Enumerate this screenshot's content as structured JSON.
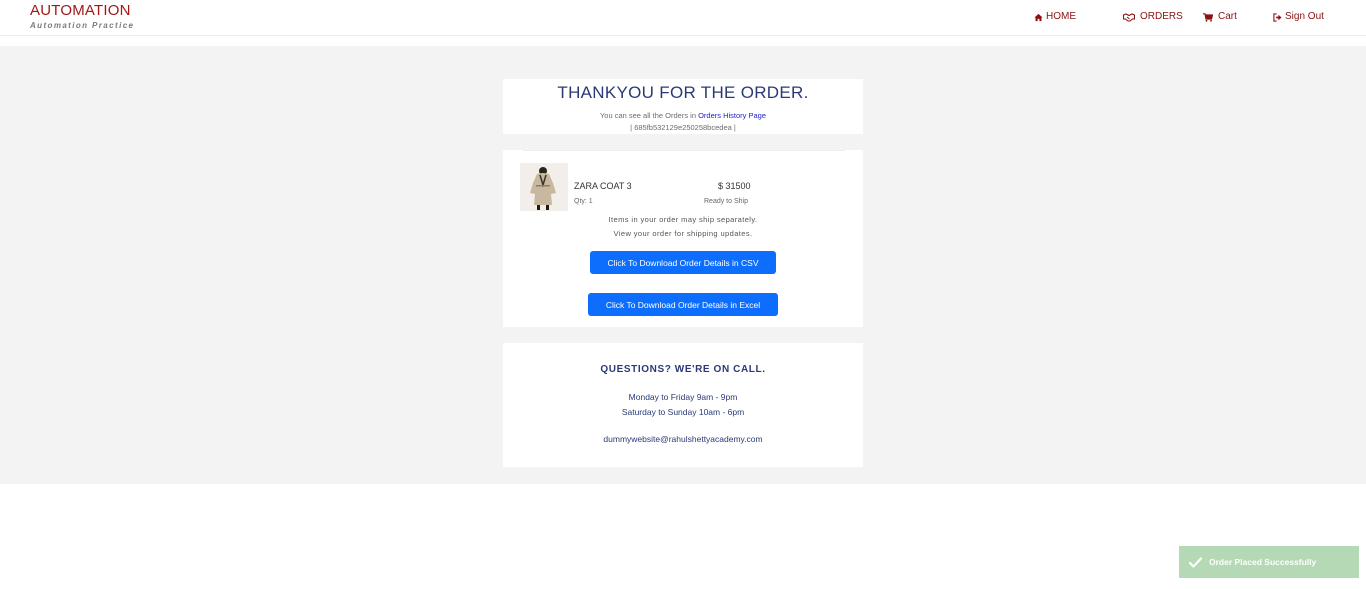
{
  "header": {
    "brand_title": "AUTOMATION",
    "brand_subtitle": "Automation Practice",
    "nav": {
      "home": "HOME",
      "orders": "ORDERS",
      "cart": "Cart",
      "sign_out": "Sign Out"
    }
  },
  "thanks": {
    "title": "THANKYOU FOR THE ORDER.",
    "line_prefix": "You can see all the Orders in ",
    "history_link": "Orders History Page",
    "order_id": "| 685fb532129e250258bcedea |"
  },
  "order": {
    "item": {
      "name": "ZARA COAT 3",
      "price": "$ 31500",
      "qty": "Qty: 1",
      "status": "Ready to Ship",
      "image_icon": "coat-product-image"
    },
    "ship_note_1": "Items in your order may ship separately.",
    "ship_note_2": "View your order for shipping updates.",
    "csv_button": "Click To Download Order Details in CSV",
    "excel_button": "Click To Download Order Details in Excel"
  },
  "contact": {
    "title": "QUESTIONS? WE'RE ON CALL.",
    "weekday": "Monday to Friday 9am - 9pm",
    "weekend": "Saturday to Sunday 10am - 6pm",
    "email": "dummywebsite@rahulshettyacademy.com"
  },
  "toast": {
    "message": "Order Placed Successfully",
    "icon": "check-icon"
  },
  "colors": {
    "brand": "#a01818",
    "navy": "#2b3a76",
    "button": "#0d6efd",
    "toast": "#b4d9b4",
    "band": "#f3f3f3"
  }
}
